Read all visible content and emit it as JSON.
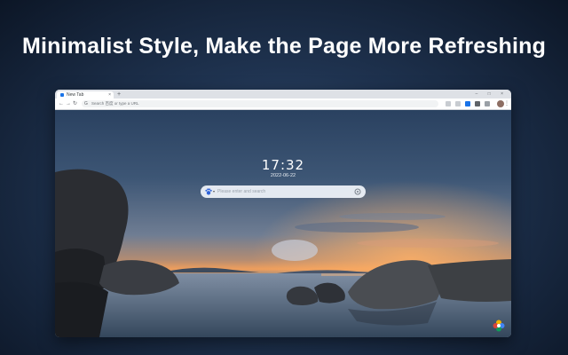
{
  "promo": {
    "headline": "Minimalist Style, Make the Page More Refreshing"
  },
  "browser": {
    "tab_title": "New Tab",
    "tab_close": "×",
    "new_tab": "+",
    "window_controls": "–  □  ×",
    "nav": {
      "back": "←",
      "forward": "→",
      "reload": "↻"
    },
    "omnibox_icon": "G",
    "omnibox_placeholder": "Search 百度 or type a URL",
    "menu": "⋮"
  },
  "newtab": {
    "time": "17:32",
    "date": "2022-06-22",
    "search_placeholder": "Please enter and search",
    "engine_caret": "▾"
  },
  "icons": {
    "search_engine": "baidu-paw-icon",
    "camera": "image-search-icon",
    "settings": "flower-settings-icon"
  },
  "colors": {
    "accent": "#1a73e8",
    "headline": "#ffffff"
  }
}
